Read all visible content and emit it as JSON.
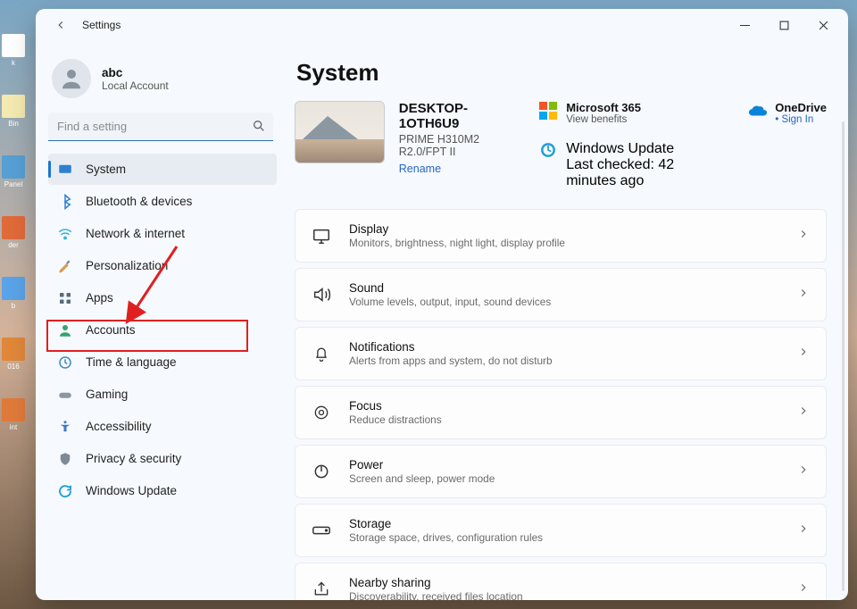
{
  "window": {
    "title": "Settings"
  },
  "account": {
    "name": "abc",
    "subtitle": "Local Account"
  },
  "search": {
    "placeholder": "Find a setting"
  },
  "nav": {
    "items": [
      {
        "id": "system",
        "label": "System"
      },
      {
        "id": "bluetooth",
        "label": "Bluetooth & devices"
      },
      {
        "id": "network",
        "label": "Network & internet"
      },
      {
        "id": "personalization",
        "label": "Personalization"
      },
      {
        "id": "apps",
        "label": "Apps"
      },
      {
        "id": "accounts",
        "label": "Accounts"
      },
      {
        "id": "time",
        "label": "Time & language"
      },
      {
        "id": "gaming",
        "label": "Gaming"
      },
      {
        "id": "accessibility",
        "label": "Accessibility"
      },
      {
        "id": "privacy",
        "label": "Privacy & security"
      },
      {
        "id": "update",
        "label": "Windows Update"
      }
    ],
    "selected": "system",
    "highlighted": "accounts"
  },
  "page": {
    "title": "System"
  },
  "device": {
    "name": "DESKTOP-1OTH6U9",
    "subtitle": "PRIME H310M2 R2.0/FPT II",
    "rename_label": "Rename"
  },
  "cloud": {
    "m365": {
      "title": "Microsoft 365",
      "subtitle": "View benefits"
    },
    "onedrive": {
      "title": "OneDrive",
      "link": "Sign In"
    },
    "update": {
      "title": "Windows Update",
      "subtitle": "Last checked: 42 minutes ago"
    }
  },
  "cards": [
    {
      "id": "display",
      "title": "Display",
      "subtitle": "Monitors, brightness, night light, display profile"
    },
    {
      "id": "sound",
      "title": "Sound",
      "subtitle": "Volume levels, output, input, sound devices"
    },
    {
      "id": "notif",
      "title": "Notifications",
      "subtitle": "Alerts from apps and system, do not disturb"
    },
    {
      "id": "focus",
      "title": "Focus",
      "subtitle": "Reduce distractions"
    },
    {
      "id": "power",
      "title": "Power",
      "subtitle": "Screen and sleep, power mode"
    },
    {
      "id": "storage",
      "title": "Storage",
      "subtitle": "Storage space, drives, configuration rules"
    },
    {
      "id": "nearby",
      "title": "Nearby sharing",
      "subtitle": "Discoverability, received files location"
    }
  ],
  "desktop_icons": [
    "k",
    "Bin",
    "Panel",
    "der",
    "b",
    "016",
    "int"
  ]
}
